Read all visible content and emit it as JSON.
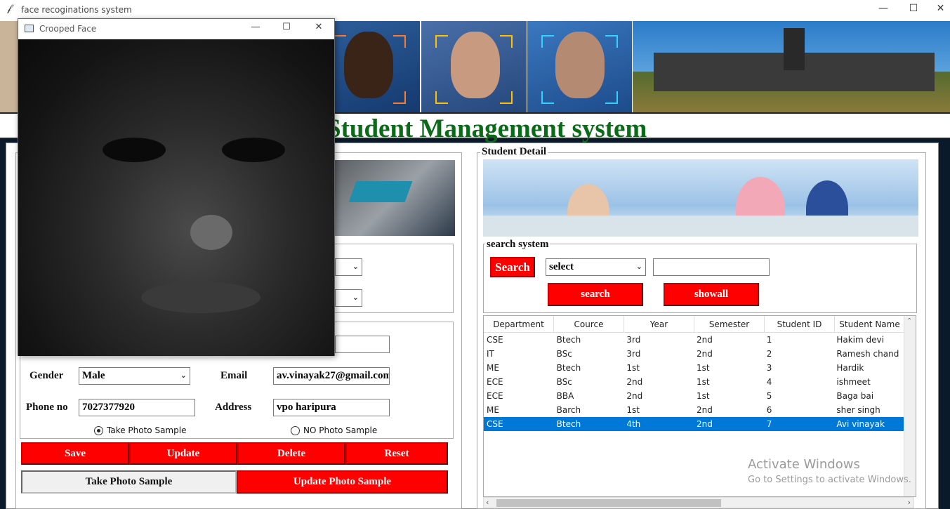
{
  "window": {
    "title": "face recoginations system",
    "min": "—",
    "max": "☐",
    "close": "✕"
  },
  "header": {
    "title": "Student Management system",
    "title_left": "Student Management system"
  },
  "left": {
    "gender_label": "Gender",
    "gender_value": "Male",
    "email_label": "Email",
    "email_value": "av.vinayak27@gmail.com",
    "phone_label": "Phone no",
    "phone_value": "7027377920",
    "address_label": "Address",
    "address_value": "vpo haripura",
    "radio_take": "Take Photo Sample",
    "radio_no": "NO Photo Sample",
    "buttons": [
      "Save",
      "Update",
      "Delete",
      "Reset"
    ],
    "take_photo": "Take Photo Sample",
    "update_photo": "Update Photo Sample"
  },
  "right": {
    "frame_title": "Student Detail",
    "search_title": "search system",
    "search_label": "Search",
    "select_value": "select",
    "search_button": "search",
    "showall_button": "showall",
    "columns": [
      "Department",
      "Cource",
      "Year",
      "Semester",
      "Student ID",
      "Student Name"
    ],
    "rows": [
      [
        "CSE",
        "Btech",
        "3rd",
        "2nd",
        "1",
        "Hakim devi"
      ],
      [
        "IT",
        "BSc",
        "3rd",
        "2nd",
        "2",
        "Ramesh chand"
      ],
      [
        "ME",
        "Btech",
        "1st",
        "1st",
        "3",
        "Hardik"
      ],
      [
        "ECE",
        "BSc",
        "2nd",
        "1st",
        "4",
        "ishmeet"
      ],
      [
        "ECE",
        "BBA",
        "2nd",
        "1st",
        "5",
        "Baga bai"
      ],
      [
        "ME",
        "Barch",
        "1st",
        "2nd",
        "6",
        "sher singh"
      ],
      [
        "CSE",
        "Btech",
        "4th",
        "2nd",
        "7",
        "Avi vinayak"
      ]
    ],
    "selected_row": 6
  },
  "popup": {
    "title": "Crooped Face"
  },
  "watermark": {
    "line1": "Activate Windows",
    "line2": "Go to Settings to activate Windows."
  }
}
